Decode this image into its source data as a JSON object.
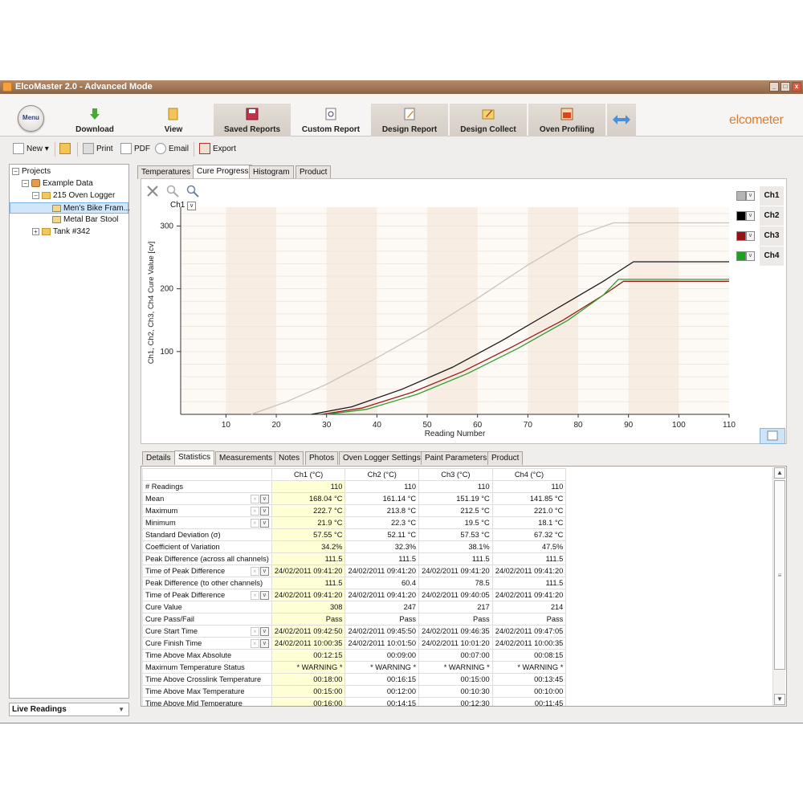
{
  "window": {
    "title": "ElcoMaster 2.0 - Advanced Mode"
  },
  "ribbon": {
    "menu_label": "Menu",
    "buttons": [
      "Download",
      "View",
      "Saved Reports",
      "Custom Report",
      "Design Report",
      "Design Collect",
      "Oven Profiling"
    ],
    "logo": "elcometer"
  },
  "toolbar": {
    "new": "New",
    "print": "Print",
    "pdf": "PDF",
    "email": "Email",
    "export": "Export"
  },
  "tree": {
    "root": "Projects",
    "example": "Example Data",
    "logger": "215 Oven Logger",
    "item_selected": "Men's Bike Fram...",
    "item2": "Metal Bar Stool",
    "tank": "Tank #342"
  },
  "live_readings": "Live Readings",
  "top_tabs": [
    "Temperatures",
    "Cure Progress",
    "Histogram",
    "Product"
  ],
  "chart_controls": {
    "channel_select": "Ch1"
  },
  "chart_data": {
    "type": "line",
    "xlabel": "Reading Number",
    "ylabel": "Ch1, Ch2, Ch3, Ch4 Cure Value [cv]",
    "xlim": [
      1,
      110
    ],
    "ylim": [
      0,
      330
    ],
    "x_ticks": [
      10,
      20,
      30,
      40,
      50,
      60,
      70,
      80,
      90,
      100,
      110
    ],
    "y_ticks": [
      100,
      200,
      300
    ],
    "series": [
      {
        "name": "Ch1",
        "color": "#c8c4c2",
        "points": [
          [
            15,
            0
          ],
          [
            22,
            20
          ],
          [
            30,
            48
          ],
          [
            40,
            90
          ],
          [
            50,
            135
          ],
          [
            60,
            185
          ],
          [
            70,
            238
          ],
          [
            80,
            285
          ],
          [
            87,
            305
          ],
          [
            110,
            305
          ]
        ]
      },
      {
        "name": "Ch2",
        "color": "#1a1a1a",
        "points": [
          [
            27,
            0
          ],
          [
            35,
            12
          ],
          [
            45,
            40
          ],
          [
            55,
            75
          ],
          [
            65,
            118
          ],
          [
            75,
            165
          ],
          [
            85,
            212
          ],
          [
            91,
            243
          ],
          [
            110,
            243
          ]
        ]
      },
      {
        "name": "Ch3",
        "color": "#9b1b1b",
        "points": [
          [
            29,
            0
          ],
          [
            37,
            10
          ],
          [
            47,
            35
          ],
          [
            57,
            68
          ],
          [
            67,
            108
          ],
          [
            77,
            150
          ],
          [
            85,
            190
          ],
          [
            89,
            212
          ],
          [
            110,
            212
          ]
        ]
      },
      {
        "name": "Ch4",
        "color": "#2aa02a",
        "points": [
          [
            30,
            0
          ],
          [
            38,
            8
          ],
          [
            48,
            32
          ],
          [
            58,
            65
          ],
          [
            68,
            105
          ],
          [
            78,
            150
          ],
          [
            85,
            190
          ],
          [
            88,
            215
          ],
          [
            110,
            215
          ]
        ]
      }
    ]
  },
  "legend": [
    {
      "label": "Ch1",
      "color": "#b5b5b5"
    },
    {
      "label": "Ch2",
      "color": "#000000"
    },
    {
      "label": "Ch3",
      "color": "#9b1010"
    },
    {
      "label": "Ch4",
      "color": "#20a020"
    }
  ],
  "bottom_tabs": [
    "Details",
    "Statistics",
    "Measurements",
    "Notes",
    "Photos",
    "Oven Logger Settings",
    "Paint Parameters",
    "Product"
  ],
  "stats": {
    "headers": [
      "",
      "Ch1 (°C)",
      "Ch2 (°C)",
      "Ch3 (°C)",
      "Ch4 (°C)"
    ],
    "rows": [
      {
        "label": "# Readings",
        "ctl": false,
        "values": [
          "110",
          "110",
          "110",
          "110"
        ]
      },
      {
        "label": "Mean",
        "ctl": true,
        "values": [
          "168.04 °C",
          "161.14 °C",
          "151.19 °C",
          "141.85 °C"
        ]
      },
      {
        "label": "Maximum",
        "ctl": true,
        "values": [
          "222.7 °C",
          "213.8 °C",
          "212.5 °C",
          "221.0 °C"
        ]
      },
      {
        "label": "Minimum",
        "ctl": true,
        "values": [
          "21.9 °C",
          "22.3 °C",
          "19.5 °C",
          "18.1 °C"
        ]
      },
      {
        "label": "Standard Deviation (σ)",
        "ctl": false,
        "values": [
          "57.55 °C",
          "52.11 °C",
          "57.53 °C",
          "67.32 °C"
        ]
      },
      {
        "label": "Coefficient of Variation",
        "ctl": false,
        "values": [
          "34.2%",
          "32.3%",
          "38.1%",
          "47.5%"
        ]
      },
      {
        "label": "Peak Difference (across all channels)",
        "ctl": false,
        "values": [
          "111.5",
          "111.5",
          "111.5",
          "111.5"
        ]
      },
      {
        "label": "Time of Peak Difference",
        "ctl": true,
        "values": [
          "24/02/2011 09:41:20",
          "24/02/2011 09:41:20",
          "24/02/2011 09:41:20",
          "24/02/2011 09:41:20"
        ]
      },
      {
        "label": "Peak Difference (to other channels)",
        "ctl": false,
        "values": [
          "111.5",
          "60.4",
          "78.5",
          "111.5"
        ]
      },
      {
        "label": "Time of Peak Difference",
        "ctl": true,
        "values": [
          "24/02/2011 09:41:20",
          "24/02/2011 09:41:20",
          "24/02/2011 09:40:05",
          "24/02/2011 09:41:20"
        ]
      },
      {
        "label": "Cure Value",
        "ctl": false,
        "values": [
          "308",
          "247",
          "217",
          "214"
        ]
      },
      {
        "label": "Cure Pass/Fail",
        "ctl": false,
        "values": [
          "Pass",
          "Pass",
          "Pass",
          "Pass"
        ]
      },
      {
        "label": "Cure Start Time",
        "ctl": true,
        "values": [
          "24/02/2011 09:42:50",
          "24/02/2011 09:45:50",
          "24/02/2011 09:46:35",
          "24/02/2011 09:47:05"
        ]
      },
      {
        "label": "Cure Finish Time",
        "ctl": true,
        "values": [
          "24/02/2011 10:00:35",
          "24/02/2011 10:01:50",
          "24/02/2011 10:01:20",
          "24/02/2011 10:00:35"
        ]
      },
      {
        "label": "Time Above Max Absolute",
        "ctl": false,
        "values": [
          "00:12:15",
          "00:09:00",
          "00:07:00",
          "00:08:15"
        ]
      },
      {
        "label": "Maximum Temperature Status",
        "ctl": false,
        "values": [
          "* WARNING *",
          "* WARNING *",
          "* WARNING *",
          "* WARNING *"
        ]
      },
      {
        "label": "Time Above Crosslink Temperature",
        "ctl": false,
        "values": [
          "00:18:00",
          "00:16:15",
          "00:15:00",
          "00:13:45"
        ]
      },
      {
        "label": "Time Above Max Temperature",
        "ctl": false,
        "values": [
          "00:15:00",
          "00:12:00",
          "00:10:30",
          "00:10:00"
        ]
      },
      {
        "label": "Time Above Mid Temperature",
        "ctl": false,
        "values": [
          "00:16:00",
          "00:14:15",
          "00:12:30",
          "00:11:45"
        ]
      }
    ]
  }
}
